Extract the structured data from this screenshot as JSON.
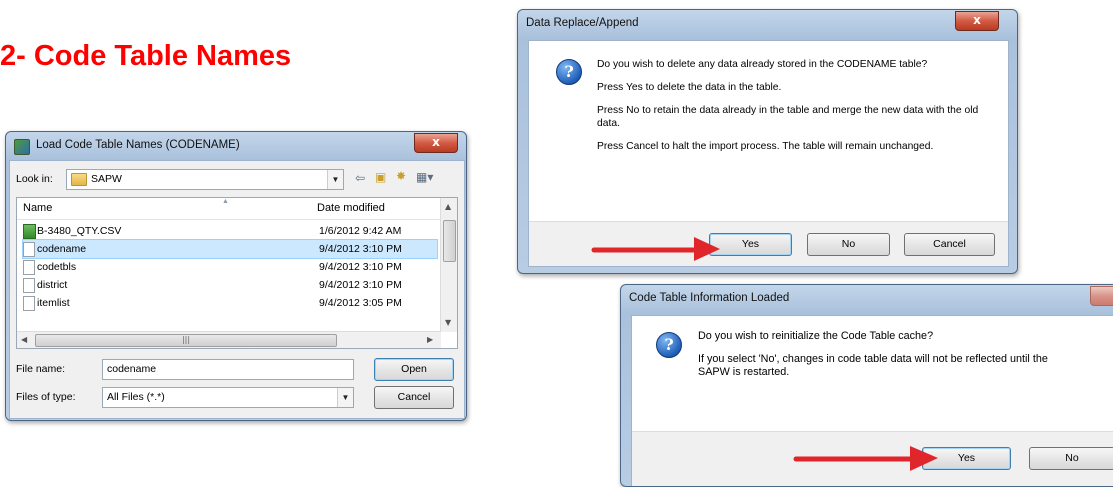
{
  "heading": "2- Code Table Names",
  "file_dialog": {
    "title": "Load Code Table Names (CODENAME)",
    "close_glyph": "x",
    "look_in_label": "Look in:",
    "look_in_value": "SAPW",
    "toolbar_icons": [
      "back-icon",
      "up-folder-icon",
      "new-folder-icon",
      "view-menu-icon"
    ],
    "columns": {
      "name": "Name",
      "date": "Date modified"
    },
    "files": [
      {
        "name": "B-3480_QTY.CSV",
        "date": "1/6/2012 9:42 AM",
        "icon": "spreadsheet-file-icon",
        "selected": false
      },
      {
        "name": "codename",
        "date": "9/4/2012 3:10 PM",
        "icon": "file-icon",
        "selected": true
      },
      {
        "name": "codetbls",
        "date": "9/4/2012 3:10 PM",
        "icon": "file-icon",
        "selected": false
      },
      {
        "name": "district",
        "date": "9/4/2012 3:10 PM",
        "icon": "file-icon",
        "selected": false
      },
      {
        "name": "itemlist",
        "date": "9/4/2012 3:05 PM",
        "icon": "file-icon",
        "selected": false
      }
    ],
    "file_name_label": "File name:",
    "file_name_value": "codename",
    "files_of_type_label": "Files of type:",
    "files_of_type_value": "All Files (*.*)",
    "open_label": "Open",
    "cancel_label": "Cancel"
  },
  "replace_dialog": {
    "title": "Data Replace/Append",
    "close_glyph": "x",
    "icon": "question-icon",
    "messages": [
      "Do you wish to delete any data already stored in the CODENAME table?",
      "Press Yes to delete the data in the table.",
      "Press No to retain the data already in the table and merge the new data with the old data.",
      "Press Cancel to halt the import process.  The table will remain unchanged."
    ],
    "yes_label": "Yes",
    "no_label": "No",
    "cancel_label": "Cancel"
  },
  "loaded_dialog": {
    "title": "Code Table Information Loaded",
    "icon": "question-icon",
    "messages": [
      "Do you wish to reinitialize the Code Table cache?",
      "If you select 'No', changes in code table data will not be reflected until the SAPW is restarted."
    ],
    "yes_label": "Yes",
    "no_label": "No"
  },
  "colors": {
    "heading": "#ff0000",
    "arrow": "#e0262b",
    "selection": "#cce8ff"
  }
}
